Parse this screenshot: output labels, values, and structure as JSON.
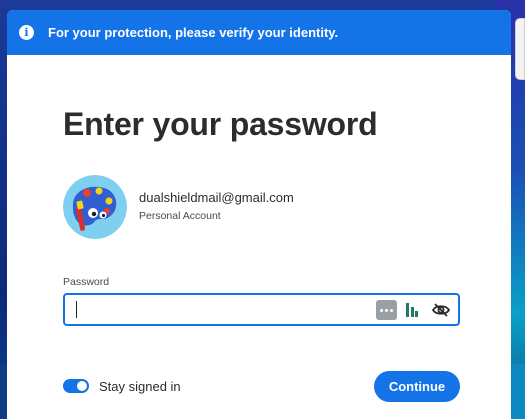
{
  "banner": {
    "icon": "info-icon",
    "text": "For your protection, please verify your identity."
  },
  "title": "Enter your password",
  "account": {
    "email": "dualshieldmail@gmail.com",
    "type": "Personal Account",
    "avatar_icon": "paint-palette-avatar"
  },
  "password": {
    "label": "Password",
    "value": "",
    "icons": [
      "password-manager-dots-icon",
      "password-manager-bars-icon",
      "eye-slash-icon"
    ]
  },
  "stay_signed_in": {
    "label": "Stay signed in",
    "checked": true
  },
  "continue_label": "Continue",
  "colors": {
    "accent": "#1473e6",
    "title_text": "#2c2c2c"
  }
}
